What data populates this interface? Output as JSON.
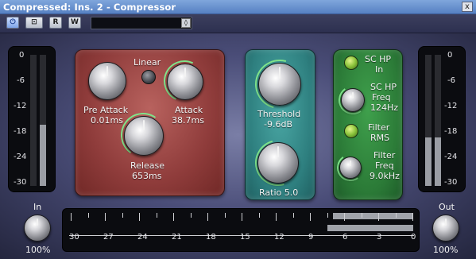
{
  "window": {
    "title": "Compressed: Ins. 2 - Compressor",
    "close_glyph": "x"
  },
  "toolbar": {
    "power_icon": "power-icon",
    "bypass_label": "⊡",
    "read_label": "R",
    "write_label": "W",
    "preset_value": "",
    "preset_arrow": "◊"
  },
  "meters": {
    "scale": [
      "0",
      "-6",
      "-12",
      "-18",
      "-24",
      "-30"
    ],
    "input_levels_db": [
      null,
      -18
    ],
    "output_levels_db": [
      -20.5,
      -20.5
    ]
  },
  "compressor": {
    "linear_label": "Linear",
    "pre_attack": {
      "label": "Pre Attack",
      "value": "0.01ms"
    },
    "attack": {
      "label": "Attack",
      "value": "38.7ms"
    },
    "release": {
      "label": "Release",
      "value": "653ms"
    },
    "threshold": {
      "label": "Threshold",
      "value": "-9.6dB"
    },
    "ratio": {
      "label": "Ratio 5.0"
    },
    "sc_hp_in": {
      "label_line1": "SC HP",
      "label_line2": "In"
    },
    "sc_hp_freq": {
      "label_line1": "SC HP",
      "label_line2": "Freq",
      "value": "124Hz"
    },
    "filter_rms": {
      "label_line1": "Filter",
      "label_line2": "RMS"
    },
    "filter_freq": {
      "label_line1": "Filter",
      "label_line2": "Freq",
      "value": "9.0kHz"
    }
  },
  "gain_reduction": {
    "scale": [
      "30",
      "27",
      "24",
      "21",
      "18",
      "15",
      "12",
      "9",
      "6",
      "3",
      "0"
    ],
    "levels_db": [
      -7,
      -7.5
    ]
  },
  "io": {
    "in_label": "In",
    "in_value": "100%",
    "out_label": "Out",
    "out_value": "100%"
  },
  "colors": {
    "title_bar": "#5680c2",
    "section_red": "#8f3c3b",
    "section_teal": "#2e7f7f",
    "section_green": "#2b7a37",
    "arc_green": "#7fe38a"
  }
}
